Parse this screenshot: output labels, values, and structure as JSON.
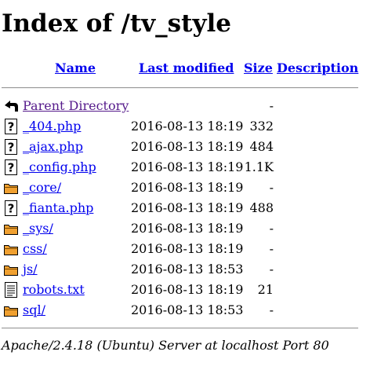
{
  "page": {
    "title": "Index of /tv_style",
    "address": "Apache/2.4.18 (Ubuntu) Server at localhost Port 80",
    "link_color": "#0000ee",
    "visited_color": "#551a8b"
  },
  "columns": {
    "name": "Name",
    "modified": "Last modified",
    "size": "Size",
    "description": "Description"
  },
  "rows": [
    {
      "icon": "back-arrow-icon",
      "name": "Parent Directory",
      "modified": "",
      "size": "-"
    },
    {
      "icon": "unknown-file-icon",
      "name": "_404.php",
      "modified": "2016-08-13 18:19",
      "size": "332"
    },
    {
      "icon": "unknown-file-icon",
      "name": "_ajax.php",
      "modified": "2016-08-13 18:19",
      "size": "484"
    },
    {
      "icon": "unknown-file-icon",
      "name": "_config.php",
      "modified": "2016-08-13 18:19",
      "size": "1.1K"
    },
    {
      "icon": "folder-icon",
      "name": "_core/",
      "modified": "2016-08-13 18:19",
      "size": "-"
    },
    {
      "icon": "unknown-file-icon",
      "name": "_fianta.php",
      "modified": "2016-08-13 18:19",
      "size": "488"
    },
    {
      "icon": "folder-icon",
      "name": "_sys/",
      "modified": "2016-08-13 18:19",
      "size": "-"
    },
    {
      "icon": "folder-icon",
      "name": "css/",
      "modified": "2016-08-13 18:19",
      "size": "-"
    },
    {
      "icon": "folder-icon",
      "name": "js/",
      "modified": "2016-08-13 18:53",
      "size": "-"
    },
    {
      "icon": "text-file-icon",
      "name": "robots.txt",
      "modified": "2016-08-13 18:19",
      "size": "21"
    },
    {
      "icon": "folder-icon",
      "name": "sql/",
      "modified": "2016-08-13 18:53",
      "size": "-"
    }
  ]
}
